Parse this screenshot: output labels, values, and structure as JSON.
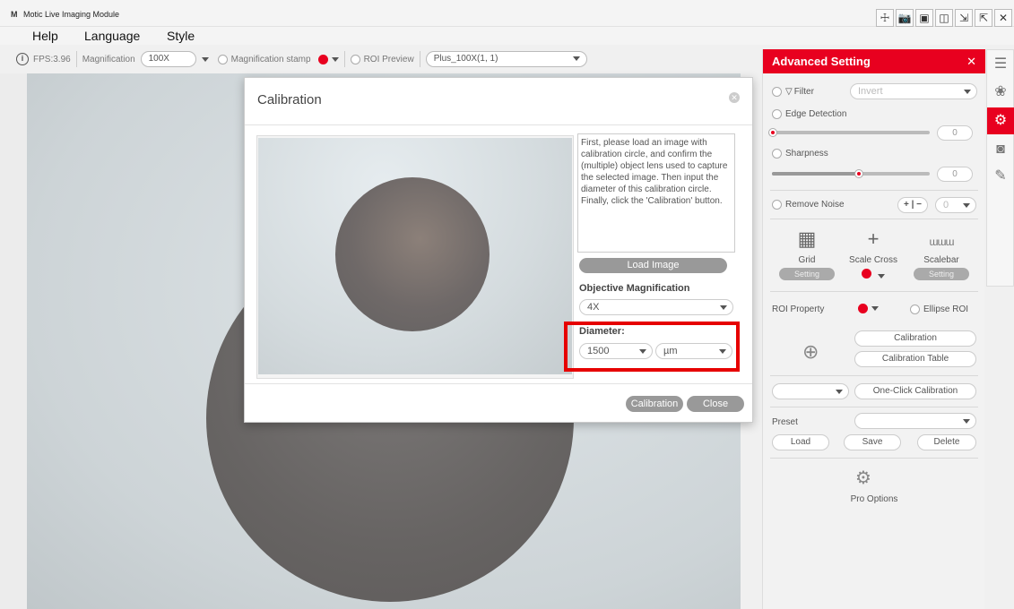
{
  "window": {
    "logo": "M",
    "title": "Motic Live Imaging Module",
    "icons": [
      "☩",
      "📷",
      "▣",
      "◫",
      "⇲",
      "⇱",
      "✕"
    ]
  },
  "menu": [
    "Help",
    "Language",
    "Style"
  ],
  "toolbar": {
    "fps": "FPS:3.96",
    "magnification_label": "Magnification",
    "magnification_value": "100X",
    "magnification_stamp": "Magnification stamp",
    "roi_preview": "ROI Preview",
    "objective_value": "Plus_100X(1, 1)"
  },
  "dialog": {
    "title": "Calibration",
    "description": "First, please load an image with calibration circle, and confirm the (multiple) object lens used to capture the selected image. Then input the diameter of this calibration circle. Finally, click the 'Calibration' button.",
    "load_image": "Load Image",
    "objective_label": "Objective Magnification",
    "objective_value": "4X",
    "diameter_label": "Diameter:",
    "diameter_value": "1500",
    "unit_value": "µm",
    "calibration_button": "Calibration",
    "close_button": "Close"
  },
  "advanced": {
    "title": "Advanced Setting",
    "filter_label": "Filter",
    "filter_value": "Invert",
    "edge_detection": "Edge Detection",
    "edge_value": "0",
    "sharpness": "Sharpness",
    "sharpness_value": "0",
    "sharpness_level": 0.55,
    "remove_noise": "Remove Noise",
    "noise_value": "0",
    "grid": "Grid",
    "grid_setting": "Setting",
    "scale_cross": "Scale Cross",
    "scalebar": "Scalebar",
    "scalebar_setting": "Setting",
    "roi_property": "ROI Property",
    "ellipse_roi": "Ellipse ROI",
    "calibration": "Calibration",
    "calibration_table": "Calibration Table",
    "one_click": "One-Click Calibration",
    "preset": "Preset",
    "load": "Load",
    "save": "Save",
    "delete": "Delete",
    "pro_options": "Pro Options"
  },
  "colors": {
    "accent": "#e8001f",
    "button_gray": "#999999"
  }
}
